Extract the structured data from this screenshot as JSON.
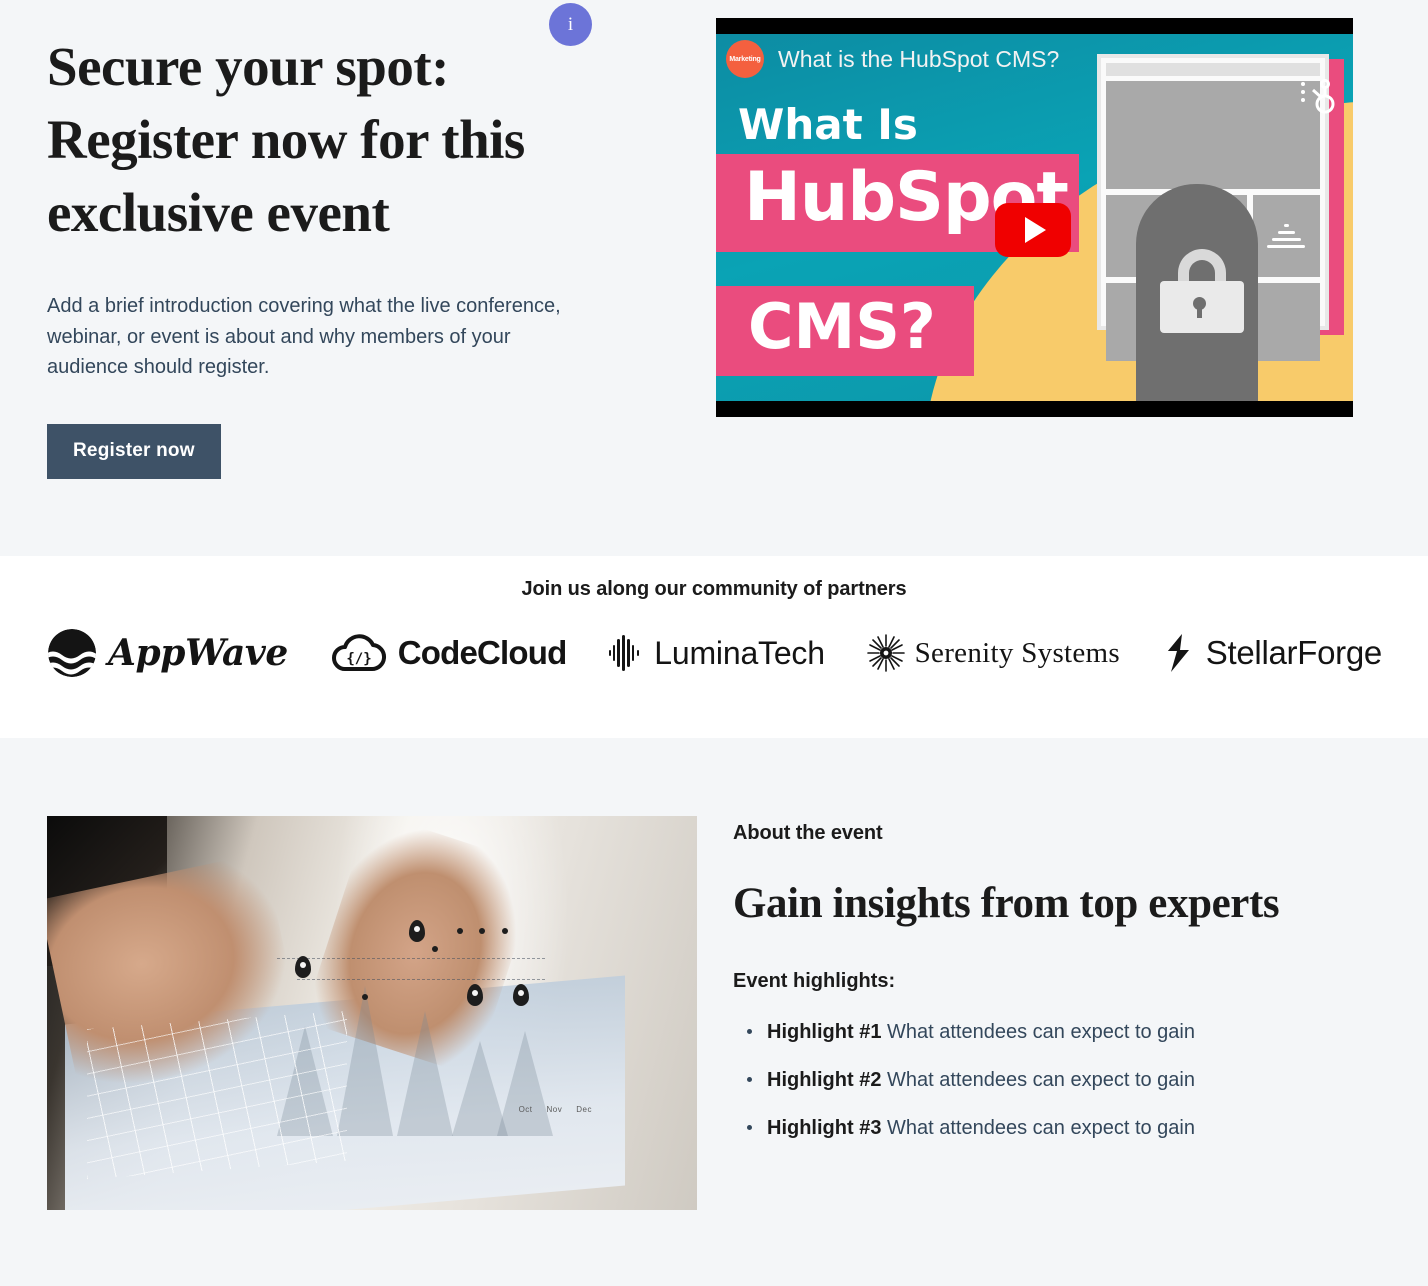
{
  "colors": {
    "hero_bg": "#f4f6f8",
    "partners_bg": "#ffffff",
    "about_bg": "#f4f6f8",
    "button": "#3e5267",
    "badge": "#6c74d8",
    "text_dark": "#1b1b1b",
    "text_body": "#33475b",
    "video_teal": "#0d95a8",
    "video_pink": "#ea4c7e",
    "video_yellow": "#f8cb6a",
    "play_red": "#f00000",
    "hubspot_orange": "#f4603f"
  },
  "hero": {
    "badge_label": "i",
    "badge_icon": "info-icon",
    "title": "Secure your spot: Register now for this exclusive event",
    "subtitle": "Add a brief introduction covering what the live conference, webinar, or event is about and why members of your audience should register.",
    "cta_label": "Register now"
  },
  "video": {
    "channel_badge": "Marketing",
    "title": "What is the HubSpot CMS?",
    "overlay_line1": "What Is",
    "overlay_line2": "HubSpot",
    "overlay_line3": "CMS?",
    "play_icon": "play-icon",
    "brand_icon": "hubspot-sprocket-icon",
    "lock_icon": "padlock-icon"
  },
  "partners": {
    "title": "Join us along our community of partners",
    "logos": [
      {
        "name": "AppWave",
        "icon": "wave-circle-icon"
      },
      {
        "name": "CodeCloud",
        "icon": "cloud-code-icon"
      },
      {
        "name": "LuminaTech",
        "icon": "waveform-icon"
      },
      {
        "name": "Serenity Systems",
        "icon": "starburst-icon"
      },
      {
        "name": "StellarForge",
        "icon": "lightning-bolt-icon"
      }
    ]
  },
  "about": {
    "eyebrow": "About the event",
    "heading": "Gain insights from top experts",
    "highlights_label": "Event highlights:",
    "image_alt": "hands-drawing-chart-photo",
    "highlights": [
      {
        "bold": "Highlight #1",
        "text": " What attendees can expect to gain"
      },
      {
        "bold": "Highlight #2",
        "text": " What attendees can expect to gain"
      },
      {
        "bold": "Highlight #3",
        "text": " What attendees can expect to gain"
      }
    ],
    "image_chart_labels": [
      "Oct",
      "Nov",
      "Dec"
    ]
  }
}
